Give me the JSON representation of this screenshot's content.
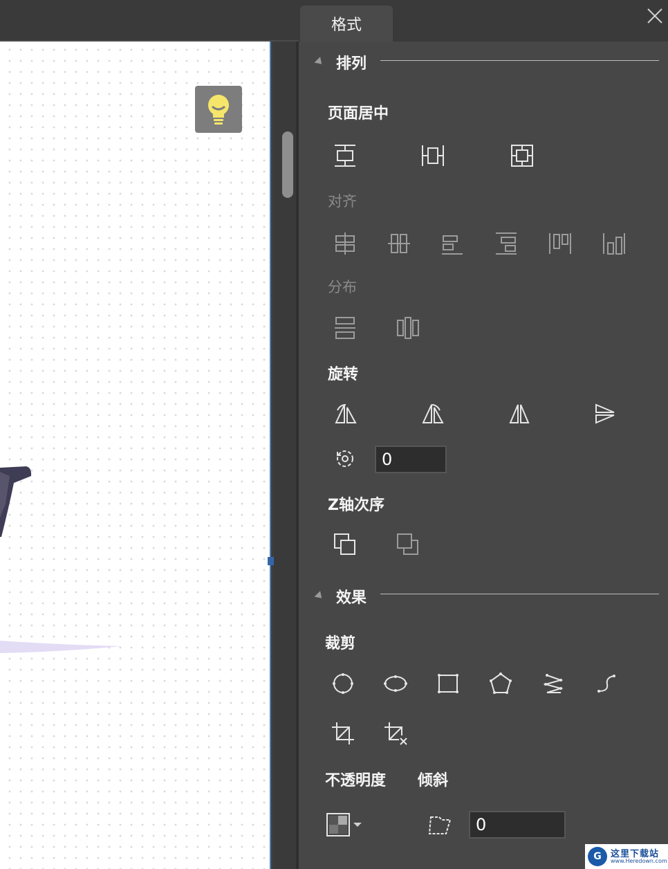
{
  "tabs": {
    "format": "格式"
  },
  "arrange": {
    "title": "排列",
    "page_center": "页面居中",
    "align": "对齐",
    "distribute": "分布",
    "rotate": "旋转",
    "rotate_value": "0",
    "z_order": "Z轴次序"
  },
  "effects": {
    "title": "效果",
    "crop": "裁剪",
    "opacity": "不透明度",
    "skew": "倾斜",
    "skew_value": "0"
  },
  "watermark": {
    "line1": "这里下载站",
    "line2": "www.Heredown.com",
    "logo": "G"
  },
  "colors": {
    "panel_bg": "#474747",
    "accent_blue": "#3567a8",
    "bulb_yellow": "#f5e66b"
  }
}
